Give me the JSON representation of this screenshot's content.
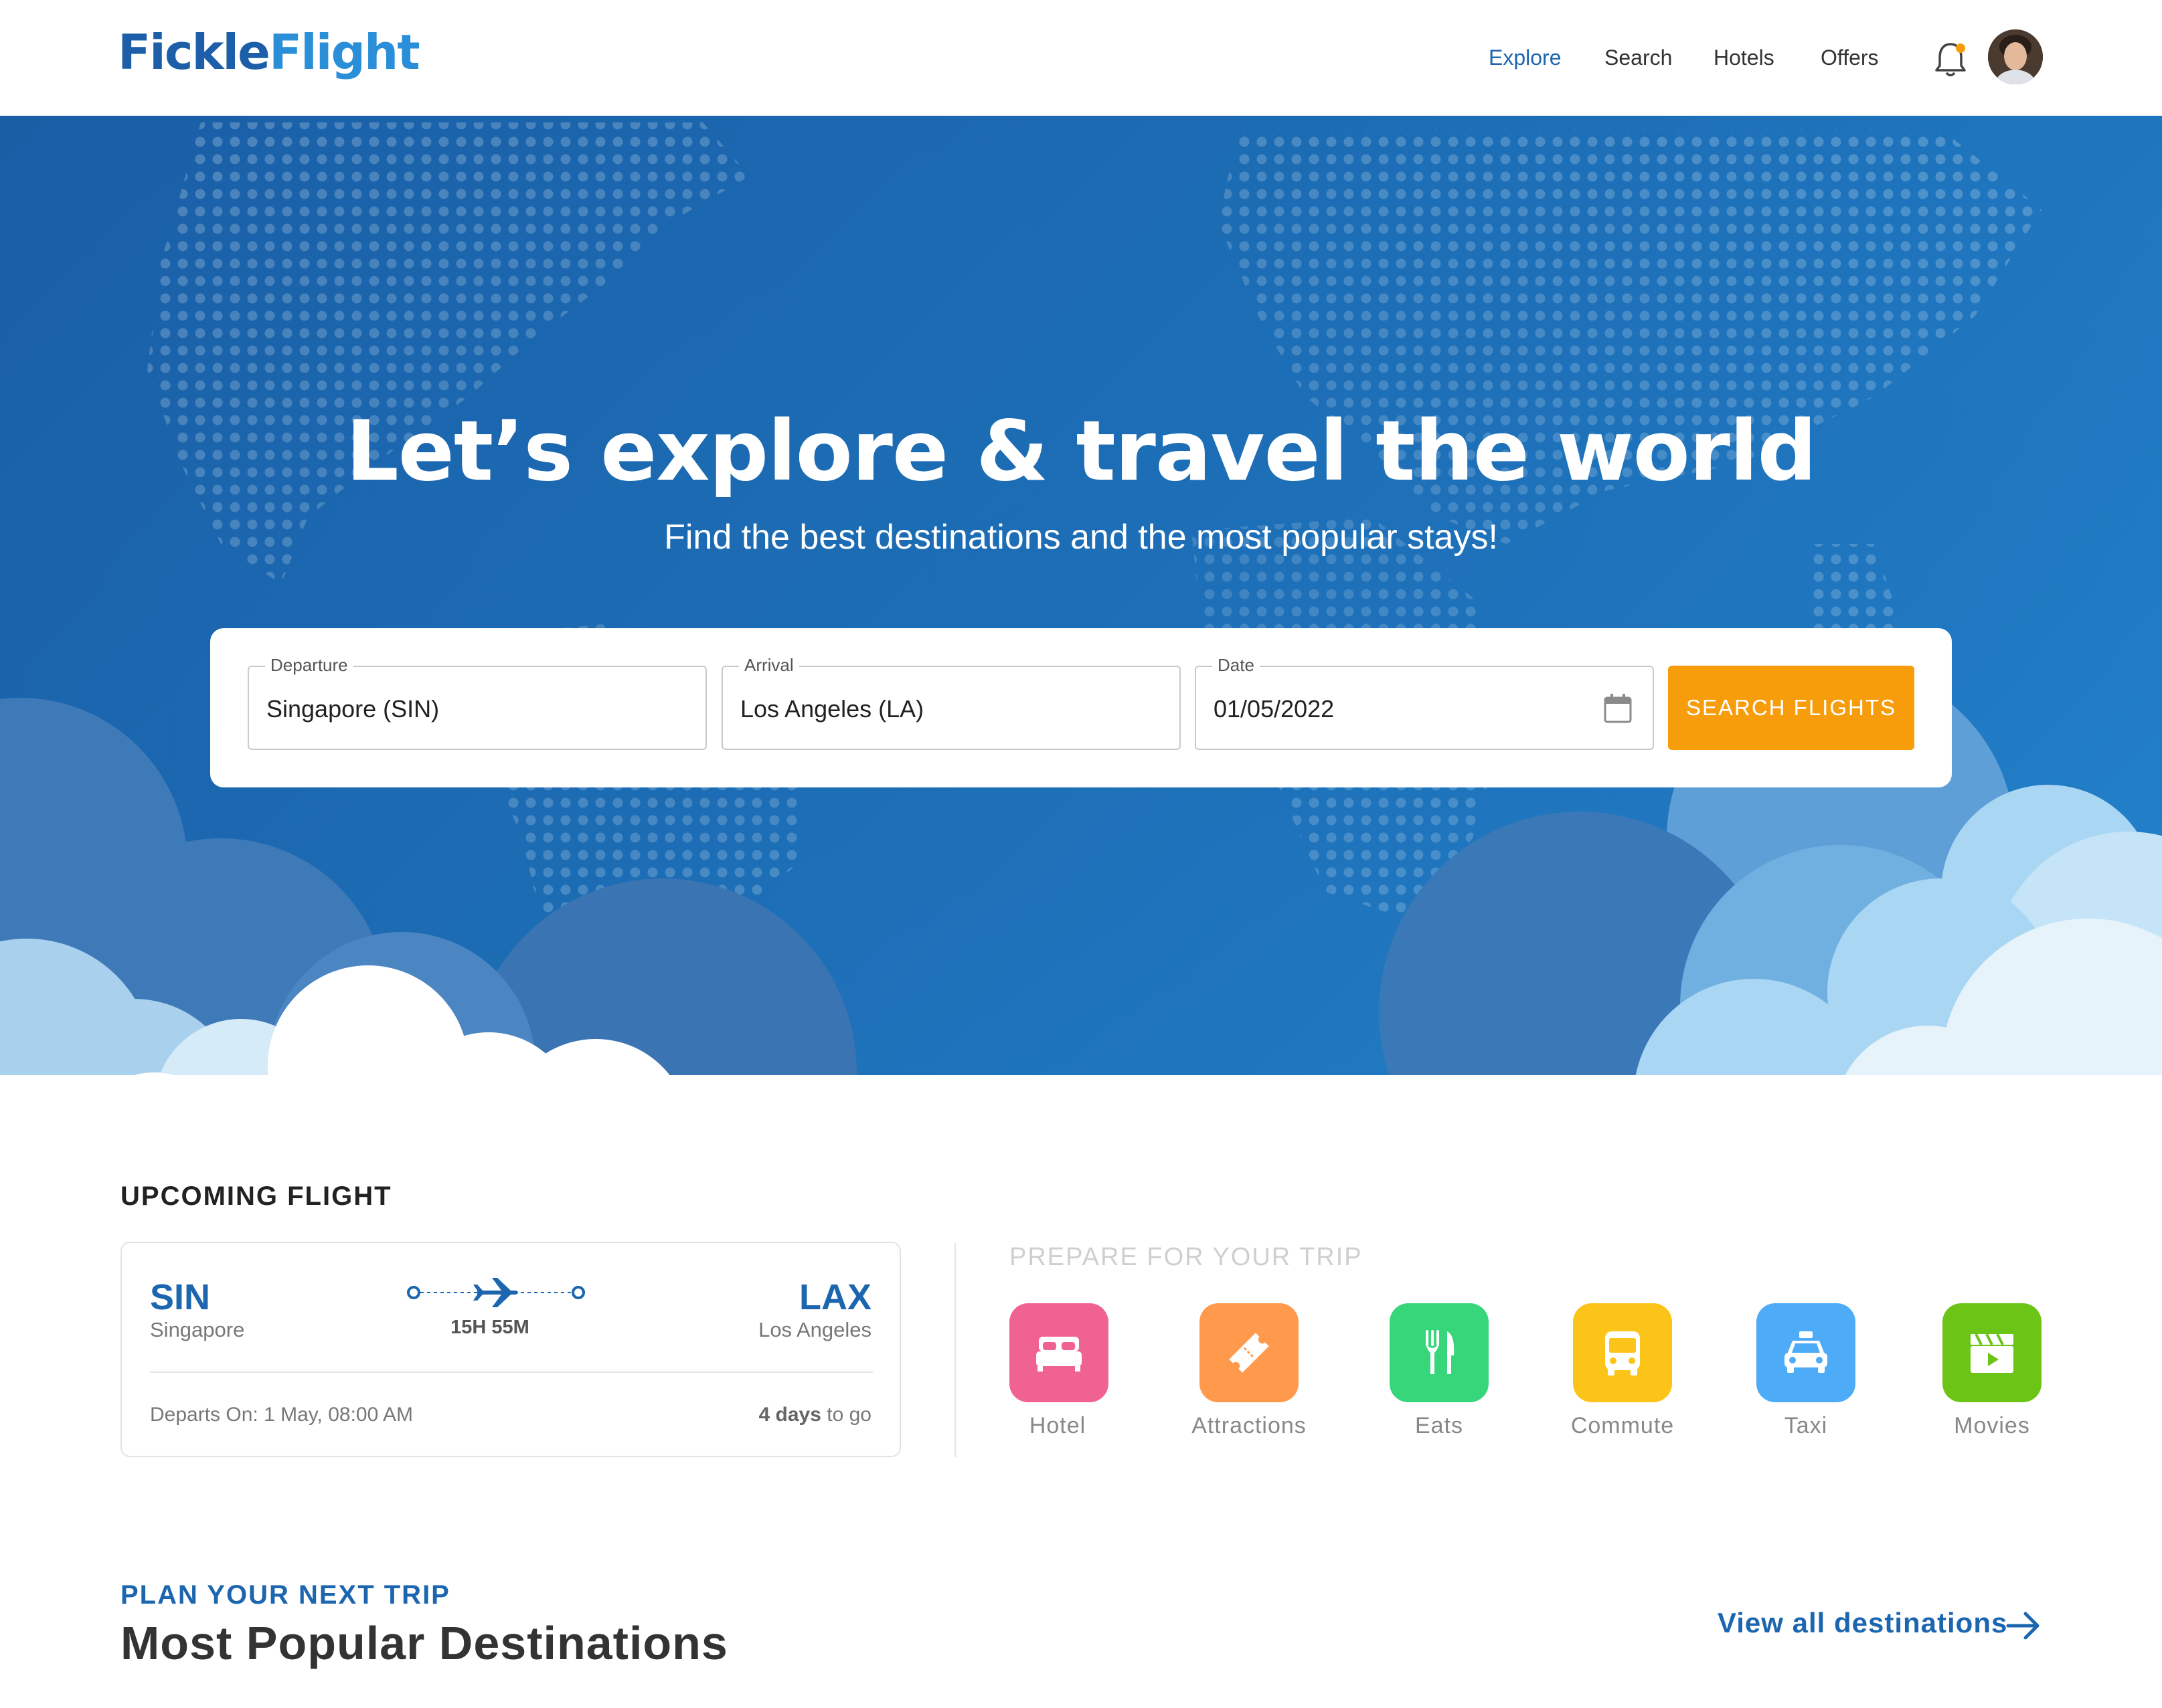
{
  "header": {
    "logo_part1": "Fickle",
    "logo_part2": "Flight",
    "nav": [
      {
        "label": "Explore",
        "active": true
      },
      {
        "label": "Search",
        "active": false
      },
      {
        "label": "Hotels",
        "active": false
      },
      {
        "label": "Offers",
        "active": false
      }
    ],
    "icons": {
      "notification": "bell-icon",
      "profile": "avatar"
    },
    "notification_dot_color": "#f79d0c"
  },
  "hero": {
    "title": "Let’s explore & travel the world",
    "subtitle": "Find the best destinations and the most popular stays!",
    "search": {
      "departure_label": "Departure",
      "departure_value": "Singapore (SIN)",
      "arrival_label": "Arrival",
      "arrival_value": "Los Angeles (LA)",
      "date_label": "Date",
      "date_value": "01/05/2022",
      "button_label": "SEARCH FLIGHTS",
      "button_color": "#f79d0c"
    }
  },
  "upcoming": {
    "section_title": "UPCOMING FLIGHT",
    "from_code": "SIN",
    "from_city": "Singapore",
    "to_code": "LAX",
    "to_city": "Los Angeles",
    "duration": "15H 55M",
    "departs": "Departs On: 1 May, 08:00 AM",
    "days_count": "4 days",
    "days_suffix": " to go"
  },
  "prepare": {
    "title": "PREPARE FOR YOUR TRIP",
    "items": [
      {
        "label": "Hotel",
        "icon": "bed-icon",
        "color": "#f06292"
      },
      {
        "label": "Attractions",
        "icon": "ticket-icon",
        "color": "#ff9a4d"
      },
      {
        "label": "Eats",
        "icon": "cutlery-icon",
        "color": "#37d67a"
      },
      {
        "label": "Commute",
        "icon": "bus-icon",
        "color": "#fcc419"
      },
      {
        "label": "Taxi",
        "icon": "taxi-icon",
        "color": "#4dabf7"
      },
      {
        "label": "Movies",
        "icon": "clapperboard-icon",
        "color": "#6cc417"
      }
    ]
  },
  "destinations": {
    "eyebrow": "PLAN YOUR NEXT TRIP",
    "title": "Most Popular Destinations",
    "view_all": "View all destinations"
  }
}
